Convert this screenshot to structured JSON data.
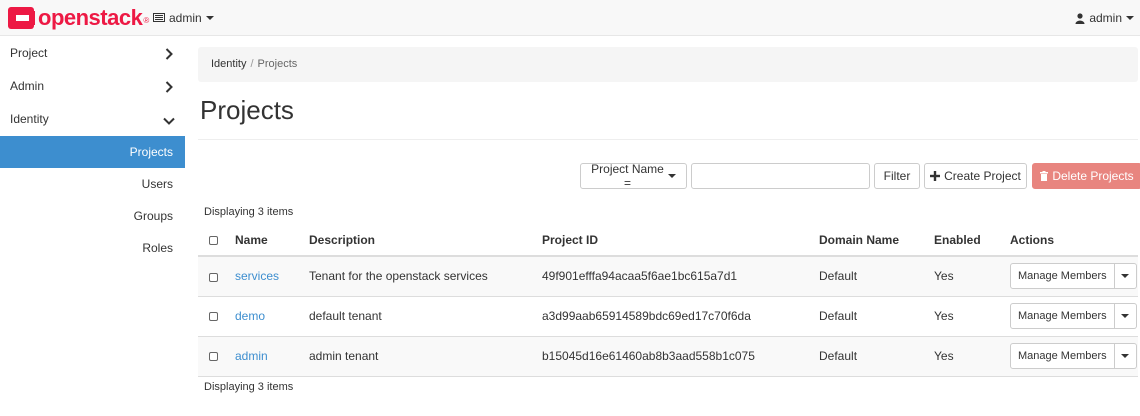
{
  "header": {
    "brand": "openstack",
    "brand_mark": "®",
    "project_menu": "admin",
    "user_menu": "admin"
  },
  "sidebar": {
    "groups": [
      {
        "label": "Project",
        "chevron": "›"
      },
      {
        "label": "Admin",
        "chevron": "›"
      },
      {
        "label": "Identity",
        "chevron": "⌄"
      }
    ],
    "items": [
      {
        "label": "Projects",
        "active": true
      },
      {
        "label": "Users"
      },
      {
        "label": "Groups"
      },
      {
        "label": "Roles"
      }
    ]
  },
  "breadcrumb": {
    "root": "Identity",
    "separator": "/",
    "current": "Projects"
  },
  "page_title": "Projects",
  "toolbar": {
    "filter_field": "Project Name =",
    "search_value": "",
    "filter_label": "Filter",
    "create_label": "Create Project",
    "delete_label": "Delete Projects"
  },
  "display_count": "Displaying 3 items",
  "table": {
    "columns": [
      "Name",
      "Description",
      "Project ID",
      "Domain Name",
      "Enabled",
      "Actions"
    ],
    "rows": [
      {
        "name": "services",
        "description": "Tenant for the openstack services",
        "project_id": "49f901efffa94acaa5f6ae1bc615a7d1",
        "domain": "Default",
        "enabled": "Yes",
        "action": "Manage Members"
      },
      {
        "name": "demo",
        "description": "default tenant",
        "project_id": "a3d99aab65914589bdc69ed17c70f6da",
        "domain": "Default",
        "enabled": "Yes",
        "action": "Manage Members"
      },
      {
        "name": "admin",
        "description": "admin tenant",
        "project_id": "b15045d16e61460ab8b3aad558b1c075",
        "domain": "Default",
        "enabled": "Yes",
        "action": "Manage Members"
      }
    ]
  },
  "colors": {
    "brand": "#ed1944",
    "active_nav": "#3d8ecf",
    "link": "#3d8ecf",
    "danger_button": "#e8857f"
  },
  "icons": {
    "project_switch": "monitor-icon",
    "user": "user-icon",
    "create": "plus-icon",
    "delete": "trash-icon"
  }
}
